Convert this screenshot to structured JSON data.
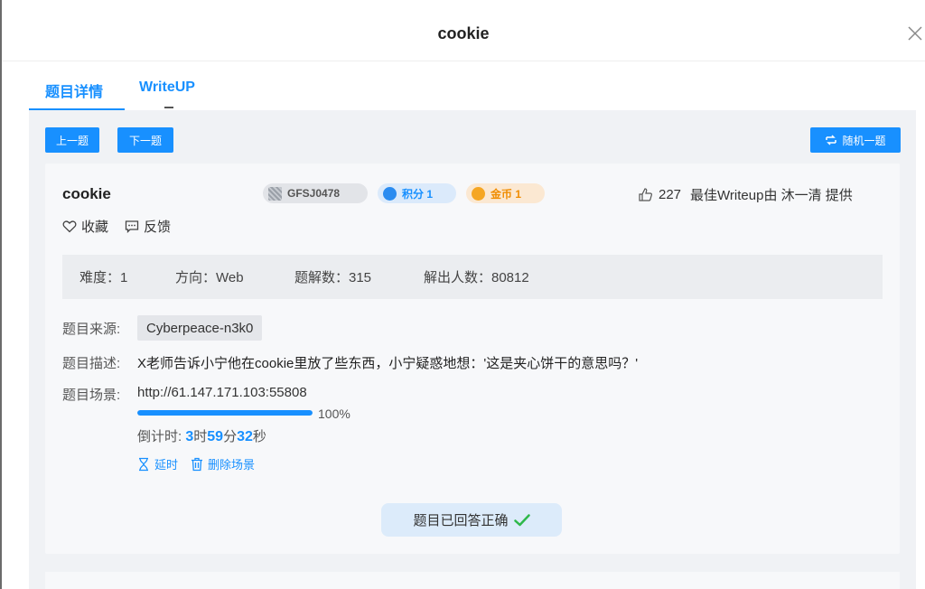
{
  "modal": {
    "title": "cookie"
  },
  "tabs": [
    {
      "label": "题目详情",
      "active": true
    },
    {
      "label": "WriteUP",
      "active": false
    }
  ],
  "nav": {
    "prev_label": "上一题",
    "next_label": "下一题",
    "random_label": "随机一题"
  },
  "task": {
    "name": "cookie",
    "tags": {
      "id": "GFSJ0478",
      "score": "积分 1",
      "coin": "金币 1"
    },
    "likes": "227",
    "best_writeup": "最佳Writeup由 沐一清 提供",
    "favorite_label": "收藏",
    "feedback_label": "反馈",
    "stats": {
      "difficulty": "难度：1",
      "direction": "方向：Web",
      "solutions": "题解数：315",
      "solvers": "解出人数：80812"
    },
    "source_label": "题目来源:",
    "source_value": "Cyberpeace-n3k0",
    "description_label": "题目描述:",
    "description_value": "X老师告诉小宁他在cookie里放了些东西，小宁疑惑地想：'这是夹心饼干的意思吗？'",
    "scene_label": "题目场景:",
    "scene_url": "http://61.147.171.103:55808",
    "progress": {
      "value": 100,
      "text": "100%"
    },
    "countdown": {
      "prefix": "倒计时: ",
      "hours": "3",
      "hours_unit": "时",
      "minutes": "59",
      "minutes_unit": "分",
      "seconds": "32",
      "seconds_unit": "秒"
    },
    "extend_label": "延时",
    "delete_scene_label": "删除场景",
    "solved_label": "题目已回答正确"
  },
  "colors": {
    "accent": "#1890ff",
    "success": "#2eb84a",
    "coin": "#f08c00"
  },
  "icons": [
    "close-icon",
    "shuffle-icon",
    "thumbs-up-icon",
    "heart-icon",
    "feedback-icon",
    "hourglass-icon",
    "trash-icon",
    "checkmark-icon"
  ]
}
